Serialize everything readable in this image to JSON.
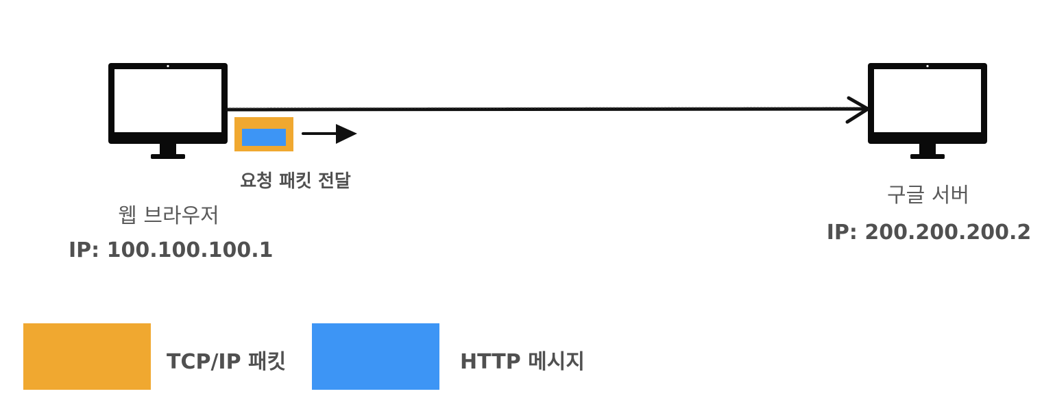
{
  "colors": {
    "tcp_packet": "#F0A830",
    "http_message": "#3D95F5",
    "monitor": "#0a0a0a",
    "text": "#505050"
  },
  "client": {
    "name": "웹 브라우저",
    "ip": "IP: 100.100.100.1",
    "icon": "desktop-monitor-icon"
  },
  "server": {
    "name": "구글 서버",
    "ip": "IP: 200.200.200.2",
    "icon": "desktop-monitor-icon"
  },
  "packet": {
    "caption": "요청 패킷 전달"
  },
  "legend": {
    "tcp_label": "TCP/IP 패킷",
    "http_label": "HTTP 메시지"
  }
}
